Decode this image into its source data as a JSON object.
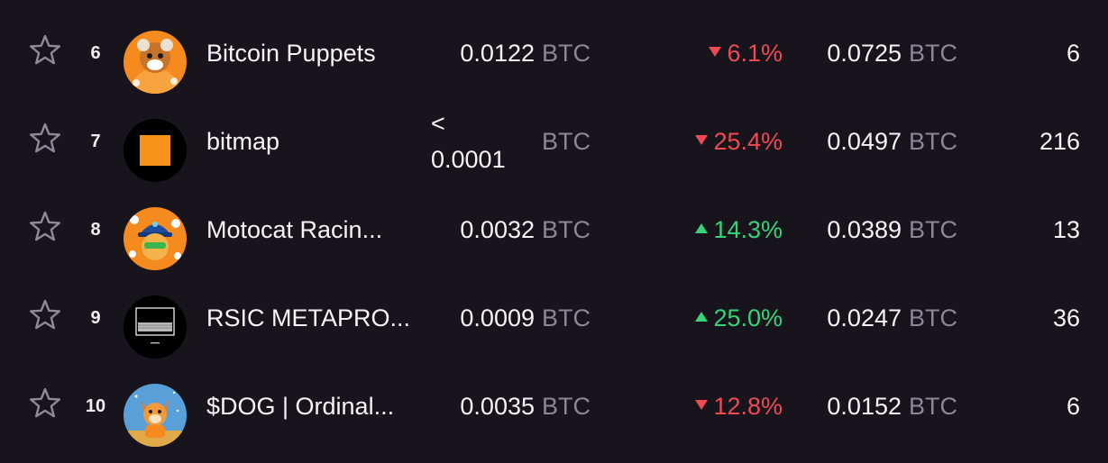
{
  "colors": {
    "background": "#17141c",
    "up": "#37d27a",
    "down": "#ee4a55",
    "muted": "#8b8795"
  },
  "rows": [
    {
      "rank": "6",
      "name": "Bitcoin Puppets",
      "floor": "0.0122",
      "floor_unit": "BTC",
      "change": "6.1%",
      "direction": "down",
      "volume": "0.0725",
      "volume_unit": "BTC",
      "sales": "6",
      "avatar_icon": "bitcoin-puppets-logo"
    },
    {
      "rank": "7",
      "name": "bitmap",
      "floor_prefix": "<",
      "floor": "0.0001",
      "floor_unit": "BTC",
      "change": "25.4%",
      "direction": "down",
      "volume": "0.0497",
      "volume_unit": "BTC",
      "sales": "216",
      "avatar_icon": "bitmap-logo"
    },
    {
      "rank": "8",
      "name": "Motocat Racin...",
      "floor": "0.0032",
      "floor_unit": "BTC",
      "change": "14.3%",
      "direction": "up",
      "volume": "0.0389",
      "volume_unit": "BTC",
      "sales": "13",
      "avatar_icon": "motocat-logo"
    },
    {
      "rank": "9",
      "name": "RSIC METAPRO...",
      "floor": "0.0009",
      "floor_unit": "BTC",
      "change": "25.0%",
      "direction": "up",
      "volume": "0.0247",
      "volume_unit": "BTC",
      "sales": "36",
      "avatar_icon": "rsic-logo"
    },
    {
      "rank": "10",
      "name": "$DOG | Ordinal...",
      "floor": "0.0035",
      "floor_unit": "BTC",
      "change": "12.8%",
      "direction": "down",
      "volume": "0.0152",
      "volume_unit": "BTC",
      "sales": "6",
      "avatar_icon": "dog-logo"
    }
  ]
}
